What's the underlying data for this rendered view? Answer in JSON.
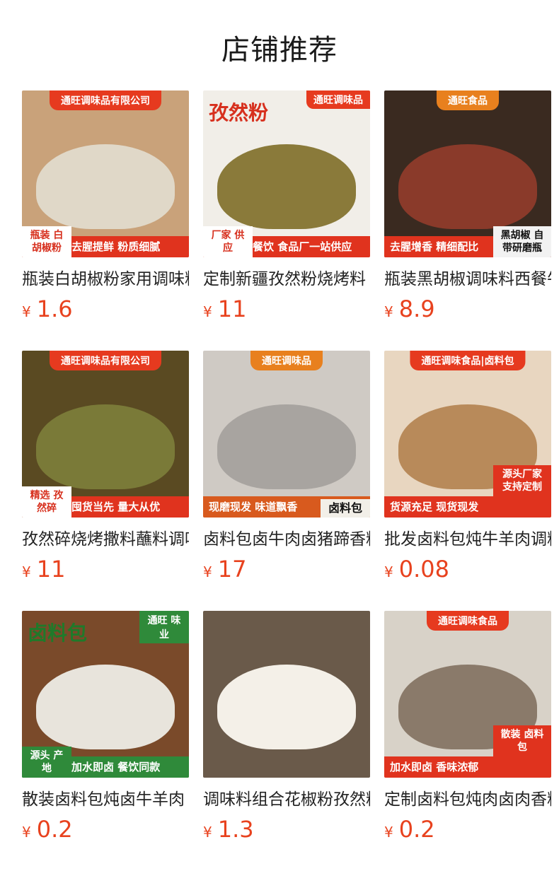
{
  "page": {
    "title": "店铺推荐"
  },
  "products": [
    {
      "name": "瓶装白胡椒粉家用调味料",
      "currency": "¥",
      "price": "1.6",
      "thumb": {
        "top": "通旺调味品有限公司",
        "headline": "",
        "banner": "去腥提鲜 粉质细腻",
        "side": "瓶装 白胡椒粉",
        "bg": "#c9a27a",
        "accent": "#e0d8c8"
      }
    },
    {
      "name": "定制新疆孜然粉烧烤料",
      "currency": "¥",
      "price": "11",
      "thumb": {
        "top": "通旺调味品",
        "headline": "孜然粉",
        "banner": "餐饮 食品厂一站供应",
        "side": "厂家 供应",
        "bg": "#f1eee8",
        "accent": "#8a7a3a"
      }
    },
    {
      "name": "瓶装黑胡椒调味料西餐牛排",
      "currency": "¥",
      "price": "8.9",
      "thumb": {
        "top": "通旺食品",
        "headline": "",
        "banner": "去腥增香 精细配比",
        "side": "黑胡椒 自带研磨瓶",
        "bg": "#3a2a20",
        "accent": "#8a3a2a"
      }
    },
    {
      "name": "孜然碎烧烤撒料蘸料调味",
      "currency": "¥",
      "price": "11",
      "thumb": {
        "top": "通旺调味品有限公司",
        "headline": "",
        "banner": "囤货当先 量大从优",
        "side": "精选 孜然碎",
        "bg": "#5a4a22",
        "accent": "#7a7a38"
      }
    },
    {
      "name": "卤料包卤牛肉卤猪蹄香料",
      "currency": "¥",
      "price": "17",
      "thumb": {
        "top": "通旺调味品",
        "headline": "",
        "banner": "现磨现发 味道飘香",
        "side": "卤料包",
        "bg": "#cfcac4",
        "accent": "#a8a4a0"
      }
    },
    {
      "name": "批发卤料包炖牛羊肉调料",
      "currency": "¥",
      "price": "0.08",
      "thumb": {
        "top": "通旺调味食品|卤料包",
        "headline": "",
        "banner": "货源充足 现货现发",
        "side": "源头厂家 支持定制",
        "bg": "#e8d6c0",
        "accent": "#b88a5a"
      }
    },
    {
      "name": "散装卤料包炖卤牛羊肉",
      "currency": "¥",
      "price": "0.2",
      "thumb": {
        "top": "通旺 味业",
        "headline": "卤料包",
        "banner": "加水即卤 餐饮同款",
        "side": "源头 产地",
        "bg": "#7a4a2a",
        "accent": "#e8e4dc"
      }
    },
    {
      "name": "调味料组合花椒粉孜然粉",
      "currency": "¥",
      "price": "1.3",
      "thumb": {
        "top": "",
        "headline": "",
        "banner": "",
        "side": "",
        "bg": "#6a5a4a",
        "accent": "#f4f0e8"
      }
    },
    {
      "name": "定制卤料包炖肉卤肉香料",
      "currency": "¥",
      "price": "0.2",
      "thumb": {
        "top": "通旺调味食品",
        "headline": "",
        "banner": "加水即卤 香味浓郁",
        "side": "散装 卤料包",
        "bg": "#d8d2c8",
        "accent": "#8a7a6a"
      }
    }
  ]
}
